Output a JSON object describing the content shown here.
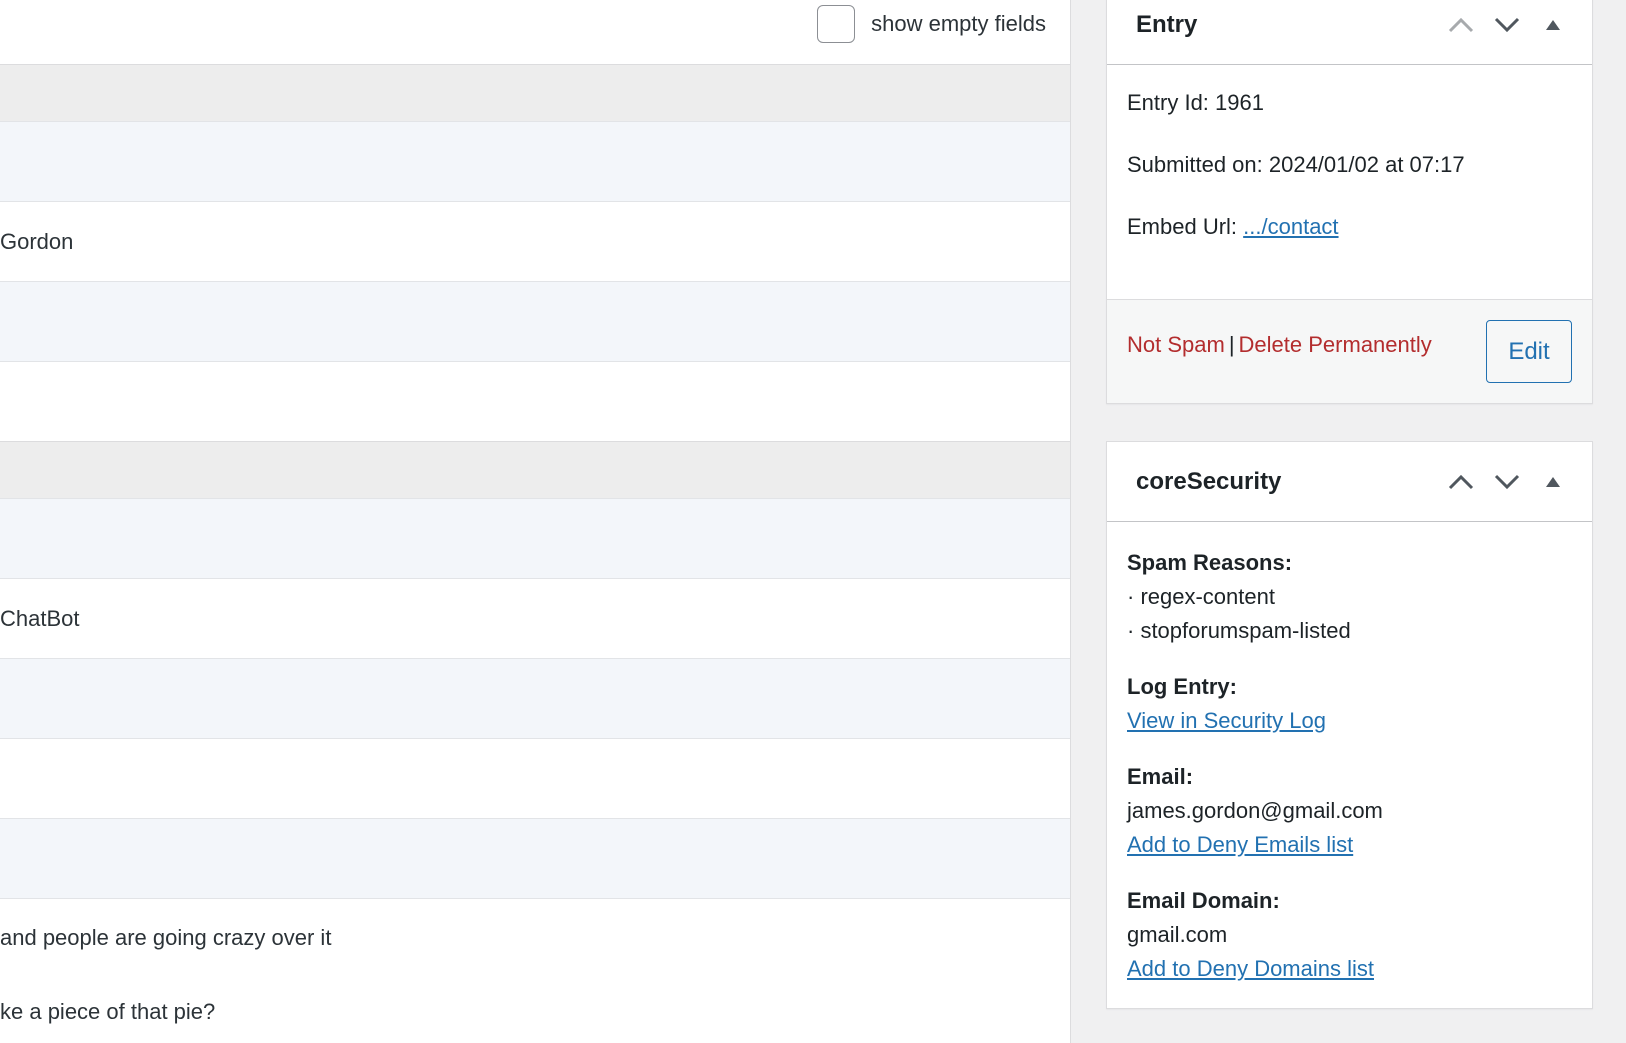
{
  "table": {
    "show_empty_label": "show empty fields",
    "rows": [
      {
        "type": "section",
        "text": ""
      },
      {
        "type": "label",
        "text": ""
      },
      {
        "type": "value",
        "text": "Gordon"
      },
      {
        "type": "label",
        "text": ""
      },
      {
        "type": "value",
        "text": ""
      },
      {
        "type": "section",
        "text": ""
      },
      {
        "type": "label",
        "text": ""
      },
      {
        "type": "value",
        "text": "ChatBot"
      },
      {
        "type": "label",
        "text": ""
      },
      {
        "type": "value",
        "text": ""
      },
      {
        "type": "label",
        "text": ""
      }
    ],
    "message_line1": "and people are going crazy over it",
    "message_line2": "ke a piece of that pie?"
  },
  "entry_box": {
    "title": "Entry",
    "entry_id": "Entry Id: 1961",
    "submitted": "Submitted on: 2024/01/02 at 07:17",
    "embed_label": "Embed Url: ",
    "embed_link": ".../contact",
    "not_spam": "Not Spam",
    "separator": "|",
    "delete": "Delete Permanently",
    "edit": "Edit"
  },
  "security_box": {
    "title": "coreSecurity",
    "spam_reasons_heading": "Spam Reasons:",
    "spam_reasons": [
      "· regex-content",
      "· stopforumspam-listed"
    ],
    "log_heading": "Log Entry:",
    "log_link": "View in Security Log",
    "email_heading": "Email:",
    "email_value": "james.gordon@gmail.com",
    "email_link": "Add to Deny Emails list",
    "domain_heading": "Email Domain:",
    "domain_value": "gmail.com",
    "domain_link": "Add to Deny Domains list"
  },
  "icons": {
    "move_up": "chevron-up-icon",
    "move_down": "chevron-down-icon",
    "toggle": "triangle-up-icon"
  },
  "colors": {
    "link": "#2271b1",
    "danger": "#b32d2e",
    "section_bg": "#ededed",
    "label_bg": "#f3f6fa"
  }
}
